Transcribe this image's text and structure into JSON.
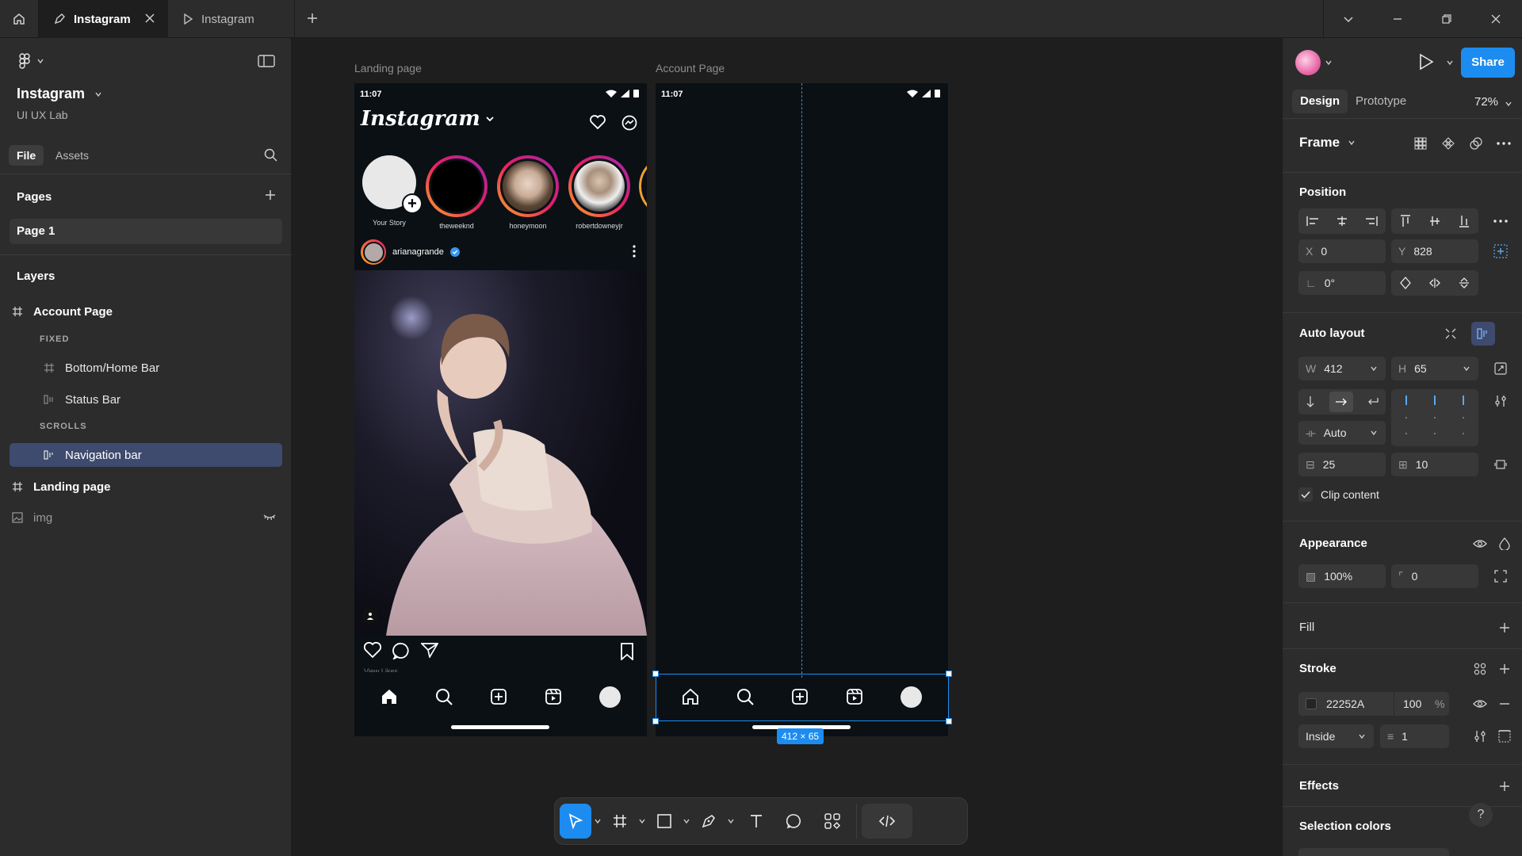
{
  "window": {
    "tabs": [
      {
        "label": "Instagram",
        "type": "design"
      },
      {
        "label": "Instagram",
        "type": "prototype"
      }
    ]
  },
  "left_panel": {
    "project_title": "Instagram",
    "project_subtitle": "UI UX Lab",
    "tab_file": "File",
    "tab_assets": "Assets",
    "pages_heading": "Pages",
    "pages": [
      "Page 1"
    ],
    "layers_heading": "Layers",
    "layers": {
      "account_page": "Account Page",
      "fixed_label": "FIXED",
      "bottom_home_bar": "Bottom/Home Bar",
      "status_bar": "Status Bar",
      "scrolls_label": "SCROLLS",
      "navigation_bar": "Navigation bar",
      "landing_page": "Landing page",
      "img": "img"
    }
  },
  "canvas": {
    "frame1_label": "Landing page",
    "frame2_label": "Account Page",
    "status_time": "11:07",
    "stories": [
      {
        "name": "Your Story"
      },
      {
        "name": "theweeknd"
      },
      {
        "name": "honeymoon"
      },
      {
        "name": "robertdowneyjr"
      }
    ],
    "post_username": "arianagrande",
    "post_caption_partial": "View Likes",
    "selection_size": "412 × 65"
  },
  "right_panel": {
    "share_label": "Share",
    "tab_design": "Design",
    "tab_prototype": "Prototype",
    "zoom": "72%",
    "frame_type": "Frame",
    "position": {
      "heading": "Position",
      "x_label": "X",
      "x_value": "0",
      "y_label": "Y",
      "y_value": "828",
      "rotation": "0°"
    },
    "auto_layout": {
      "heading": "Auto layout",
      "w_label": "W",
      "w_value": "412",
      "h_label": "H",
      "h_value": "65",
      "gap_mode": "Auto",
      "padding_h": "25",
      "padding_v": "10",
      "clip_content": "Clip content"
    },
    "appearance": {
      "heading": "Appearance",
      "opacity": "100%",
      "radius": "0"
    },
    "fill_heading": "Fill",
    "stroke": {
      "heading": "Stroke",
      "color_hex": "22252A",
      "opacity": "100",
      "percent": "%",
      "position": "Inside",
      "weight": "1"
    },
    "effects_heading": "Effects",
    "selection_colors_heading": "Selection colors"
  },
  "colors": {
    "accent": "#1d8cf0",
    "stroke_swatch": "#22252A"
  }
}
